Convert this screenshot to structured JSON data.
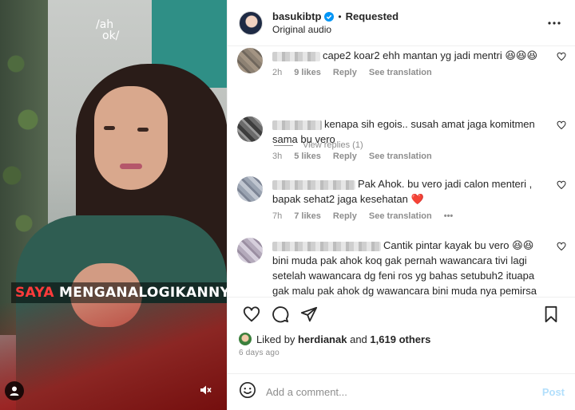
{
  "video": {
    "watermark_line1": "/ah",
    "watermark_line2": "ok/",
    "caption_highlight": "SAYA",
    "caption_rest": " MENGANALOGIKANNYA ITU",
    "user_icon": "user-icon",
    "mute_icon": "speaker-muted-icon"
  },
  "header": {
    "username": "basukibtp",
    "status": "Requested",
    "separator": "•",
    "subtitle": "Original audio",
    "verified_color": "#0095f6"
  },
  "comments": [
    {
      "name_visible": "",
      "text": "cape2 koar2 ehh mantan yg jadi mentri 😆😆😆",
      "time": "2h",
      "likes": "9 likes",
      "reply": "Reply",
      "translate": "See translation"
    },
    {
      "name_visible": "",
      "text": "kenapa sih egois.. susah amat jaga komitmen sama bu vero",
      "time": "3h",
      "likes": "5 likes",
      "reply": "Reply",
      "translate": "See translation"
    },
    {
      "name_visible": "",
      "text": "Pak Ahok. bu vero jadi calon menteri , bapak sehat2 jaga kesehatan ❤️",
      "time": "7h",
      "likes": "7 likes",
      "reply": "Reply",
      "translate": "See translation",
      "more": "•••"
    },
    {
      "name_visible": "",
      "text": "Cantik pintar kayak bu vero 😆😆 bini muda pak ahok koq gak pernah wawancara tivi lagi setelah wawancara dg feni ros yg bahas setubuh2 ituapa gak malu pak ahok dg wawancara bini muda nya pemirsa ini malu liat tv",
      "time": "",
      "likes": "",
      "reply": "",
      "translate": ""
    }
  ],
  "view_replies": "View replies (1)",
  "likes": {
    "prefix": "Liked by",
    "user": "herdianak",
    "and": "and",
    "count": "1,619 others"
  },
  "timestamp": "6 days ago",
  "composer": {
    "placeholder": "Add a comment...",
    "post": "Post"
  }
}
